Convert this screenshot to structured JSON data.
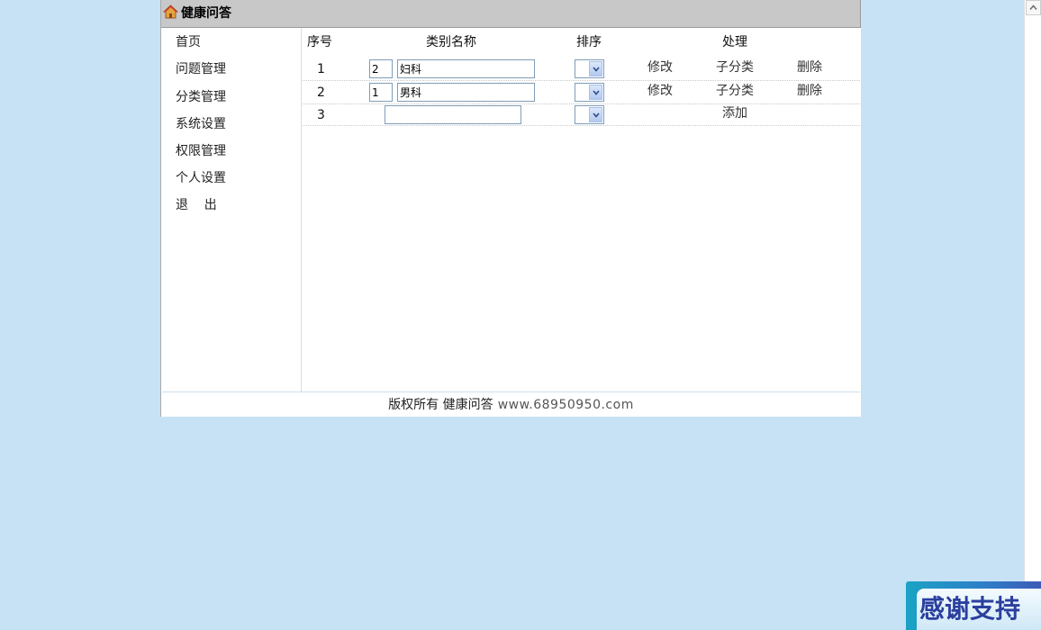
{
  "app": {
    "title": "健康问答",
    "icon": "home-icon"
  },
  "sidebar": {
    "items": [
      {
        "label": "首页"
      },
      {
        "label": "问题管理"
      },
      {
        "label": "分类管理"
      },
      {
        "label": "系统设置"
      },
      {
        "label": "权限管理"
      },
      {
        "label": "个人设置"
      },
      {
        "label": "退    出"
      }
    ]
  },
  "table": {
    "headers": {
      "index": "序号",
      "name": "类别名称",
      "order": "排序",
      "actions": "处理"
    },
    "rows": [
      {
        "index": "1",
        "order_value": "2",
        "name": "妇科",
        "edit": "修改",
        "sub": "子分类",
        "delete": "删除"
      },
      {
        "index": "2",
        "order_value": "1",
        "name": "男科",
        "edit": "修改",
        "sub": "子分类",
        "delete": "删除"
      }
    ],
    "new_row": {
      "index": "3",
      "name": "",
      "add": "添加"
    }
  },
  "footer": {
    "text": "版权所有 健康问答",
    "url": "www.68950950.com"
  },
  "badge": {
    "text": "感谢支持"
  },
  "colors": {
    "page_bg": "#c7e2f5",
    "titlebar_bg": "#c8c8c8",
    "badge_text": "#2b3f9e"
  }
}
